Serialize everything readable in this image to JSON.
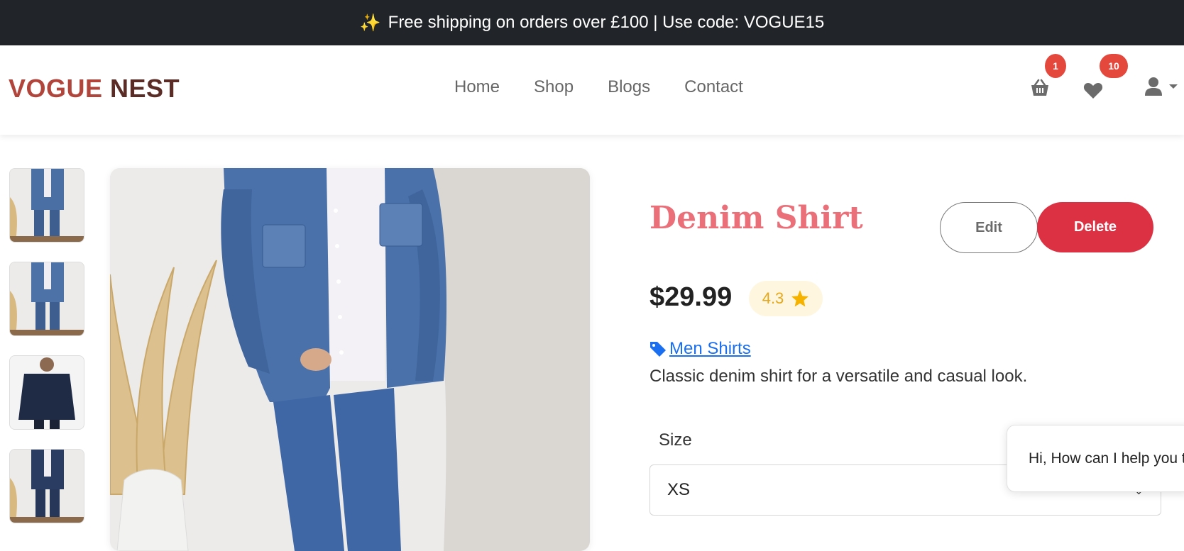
{
  "promo": {
    "icon": "sparkles-icon",
    "text": "Free shipping on orders over £100 | Use code: VOGUE15"
  },
  "brand": {
    "part1": "VOGUE",
    "part2": "NEST"
  },
  "nav": {
    "home": "Home",
    "shop": "Shop",
    "blogs": "Blogs",
    "contact": "Contact"
  },
  "icons": {
    "cart": {
      "icon": "basket-icon",
      "count": "1"
    },
    "wishlist": {
      "icon": "heart-icon",
      "count": "10"
    },
    "account": {
      "icon": "user-icon"
    }
  },
  "product": {
    "title": "Denim Shirt",
    "price": "$29.99",
    "rating": "4.3",
    "category": "Men Shirts",
    "description": "Classic denim shirt for a versatile and casual look.",
    "size_label": "Size",
    "size_value": "XS"
  },
  "actions": {
    "edit": "Edit",
    "delete": "Delete"
  },
  "chat": {
    "message": "Hi, How can I help you t"
  },
  "colors": {
    "promo_bg": "#212529",
    "brand": "#b2453b",
    "title": "#ea6f79",
    "delete": "#dc3143",
    "badge": "#e4473b",
    "link": "#1a6ff0",
    "rating_bg": "#fff6e0"
  }
}
